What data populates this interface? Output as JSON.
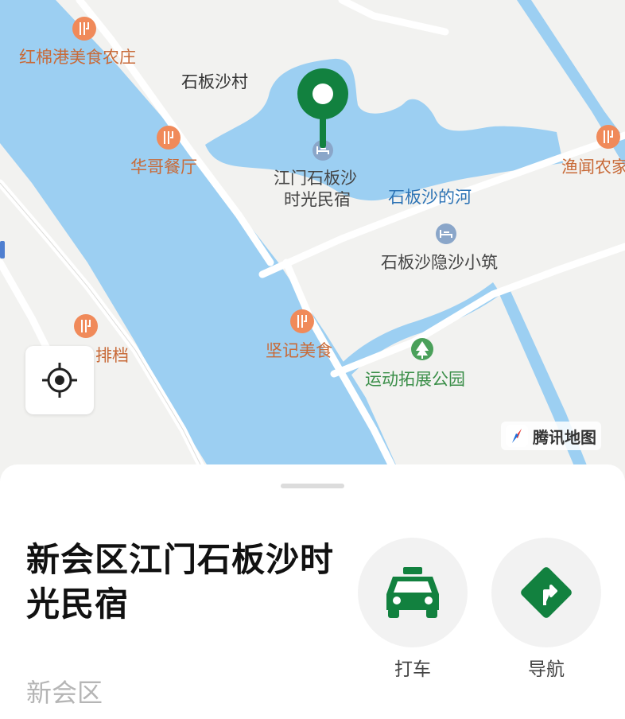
{
  "map": {
    "labels": {
      "hongmian": "红棉港美食农庄",
      "village": "石板沙村",
      "huage": "华哥餐厅",
      "minsu_line1": "江门石板沙",
      "minsu_line2": "时光民宿",
      "river": "石板沙的河",
      "yinsha": "石板沙隐沙小筑",
      "yuwen": "渔闻农家",
      "paidang": "排档",
      "jianji": "坚记美食",
      "park": "运动拓展公园"
    },
    "brand": "腾讯地图",
    "colors": {
      "water": "#9ccff2",
      "land": "#f2f2f0",
      "road": "#ffffff",
      "poi": "#f08a5a",
      "pin": "#12813f",
      "park": "#4aa05a"
    }
  },
  "place": {
    "name": "新会区江门石板沙时光民宿",
    "district": "新会区"
  },
  "actions": [
    {
      "label": "打车",
      "icon": "taxi-icon"
    },
    {
      "label": "导航",
      "icon": "navigation-icon"
    }
  ]
}
